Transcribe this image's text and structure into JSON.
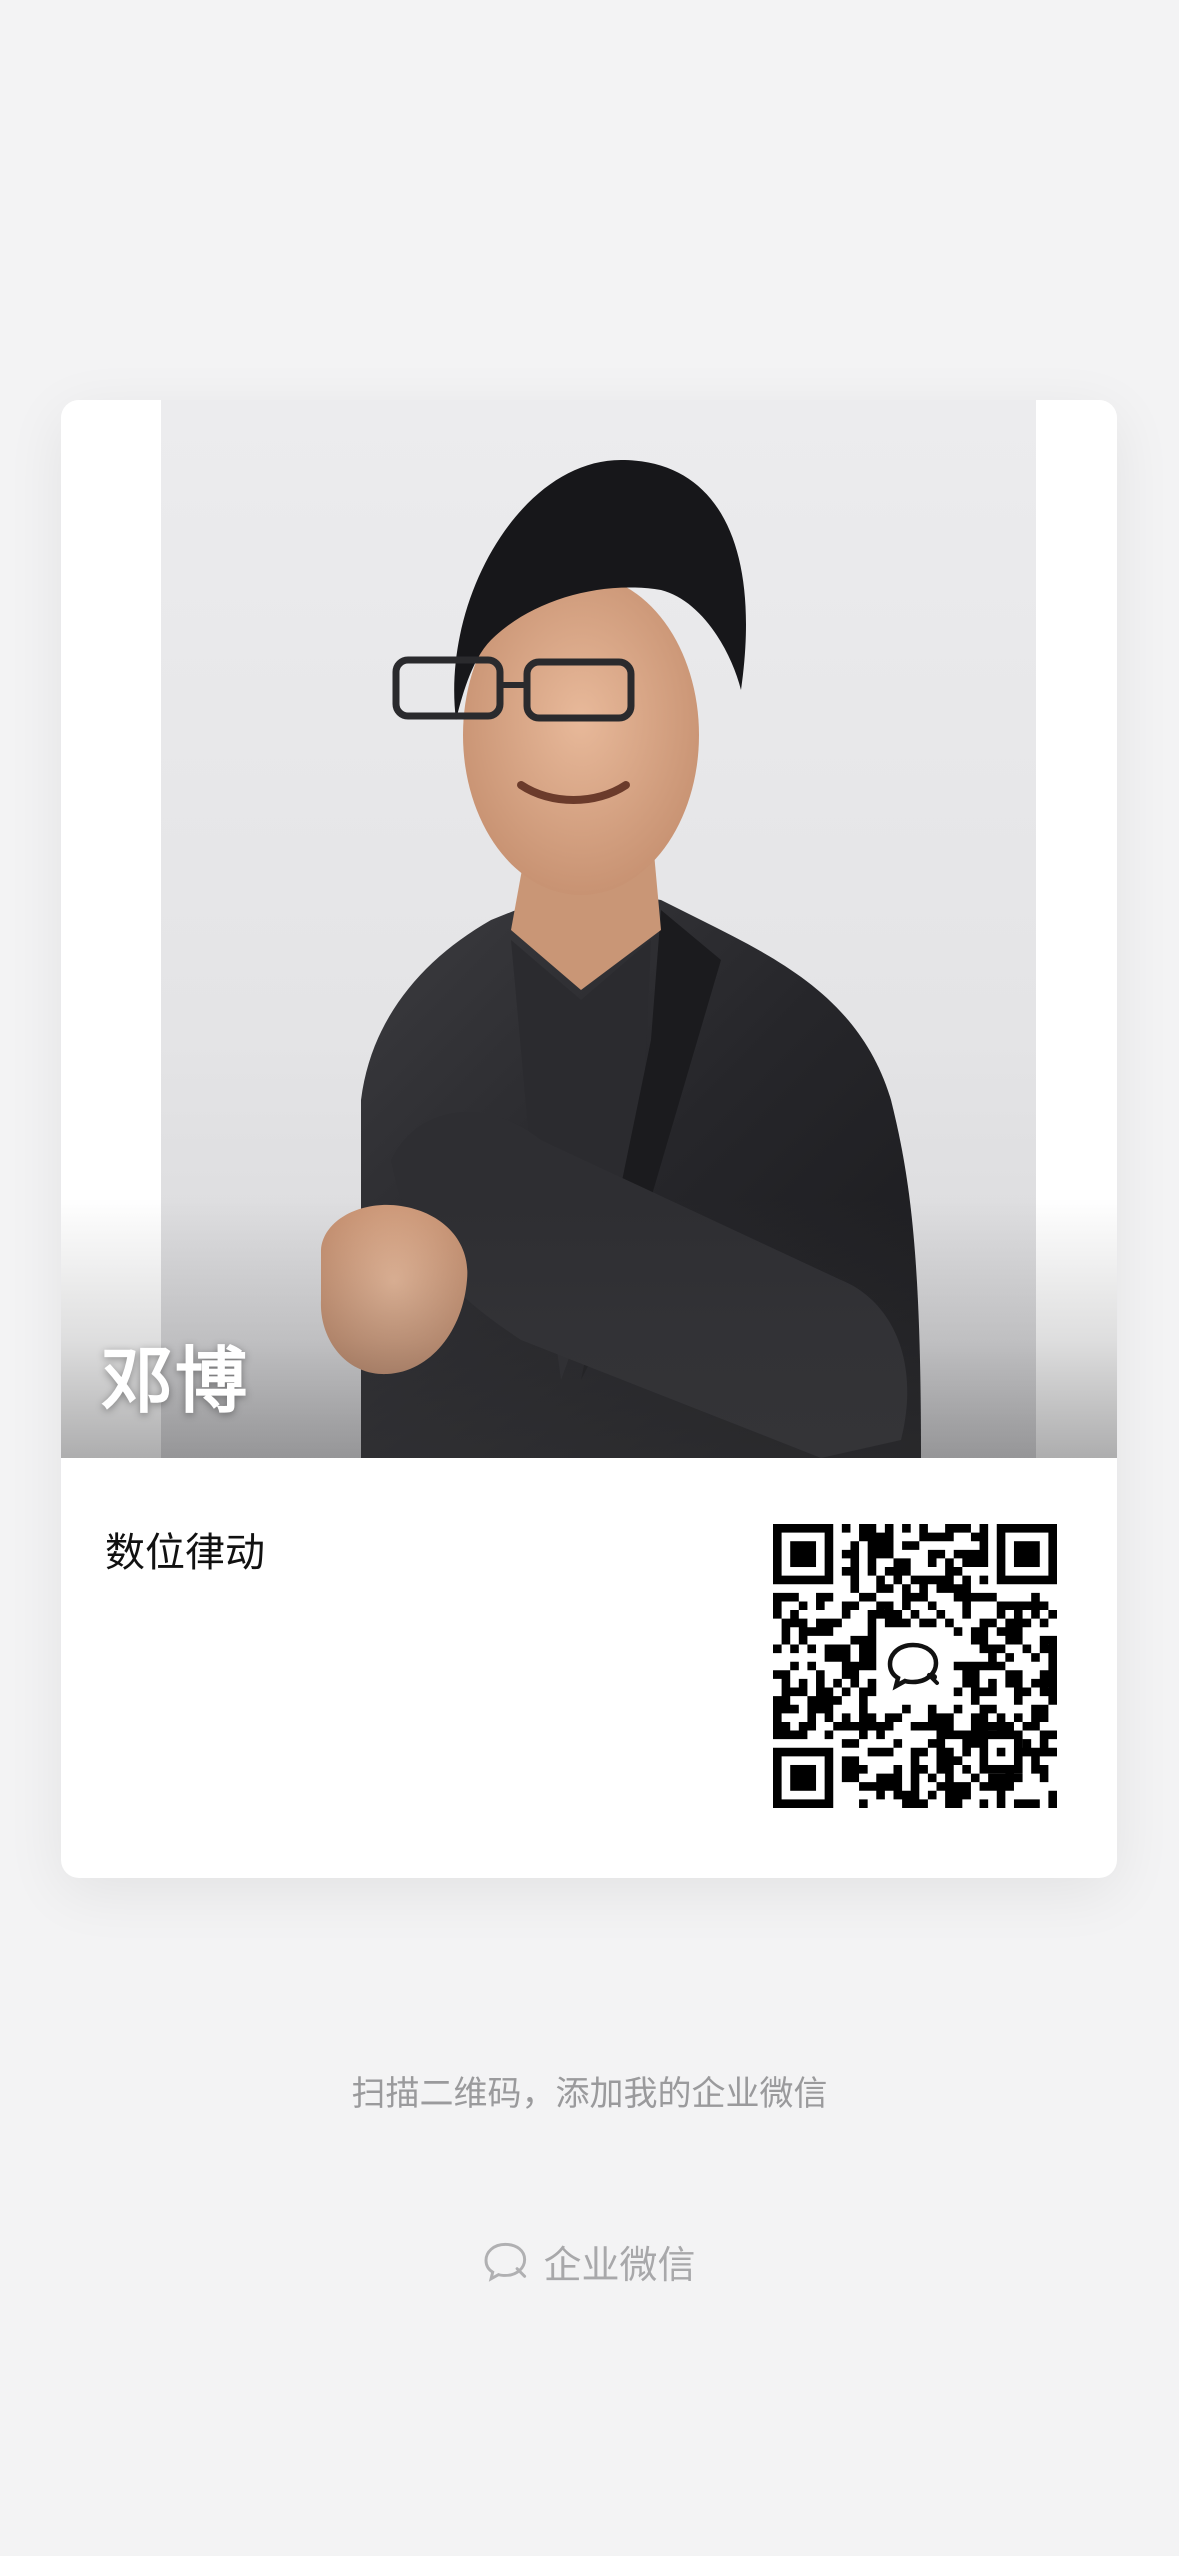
{
  "card": {
    "name": "邓博",
    "company": "数位律动"
  },
  "qr": {
    "logo_icon": "wecom-chat-icon"
  },
  "hint": "扫描二维码，添加我的企业微信",
  "footer": {
    "icon": "wecom-chat-icon",
    "label": "企业微信"
  },
  "colors": {
    "background": "#f3f3f4",
    "card": "#ffffff",
    "hint_text": "#9a9a9c",
    "name_text": "#ffffff"
  }
}
